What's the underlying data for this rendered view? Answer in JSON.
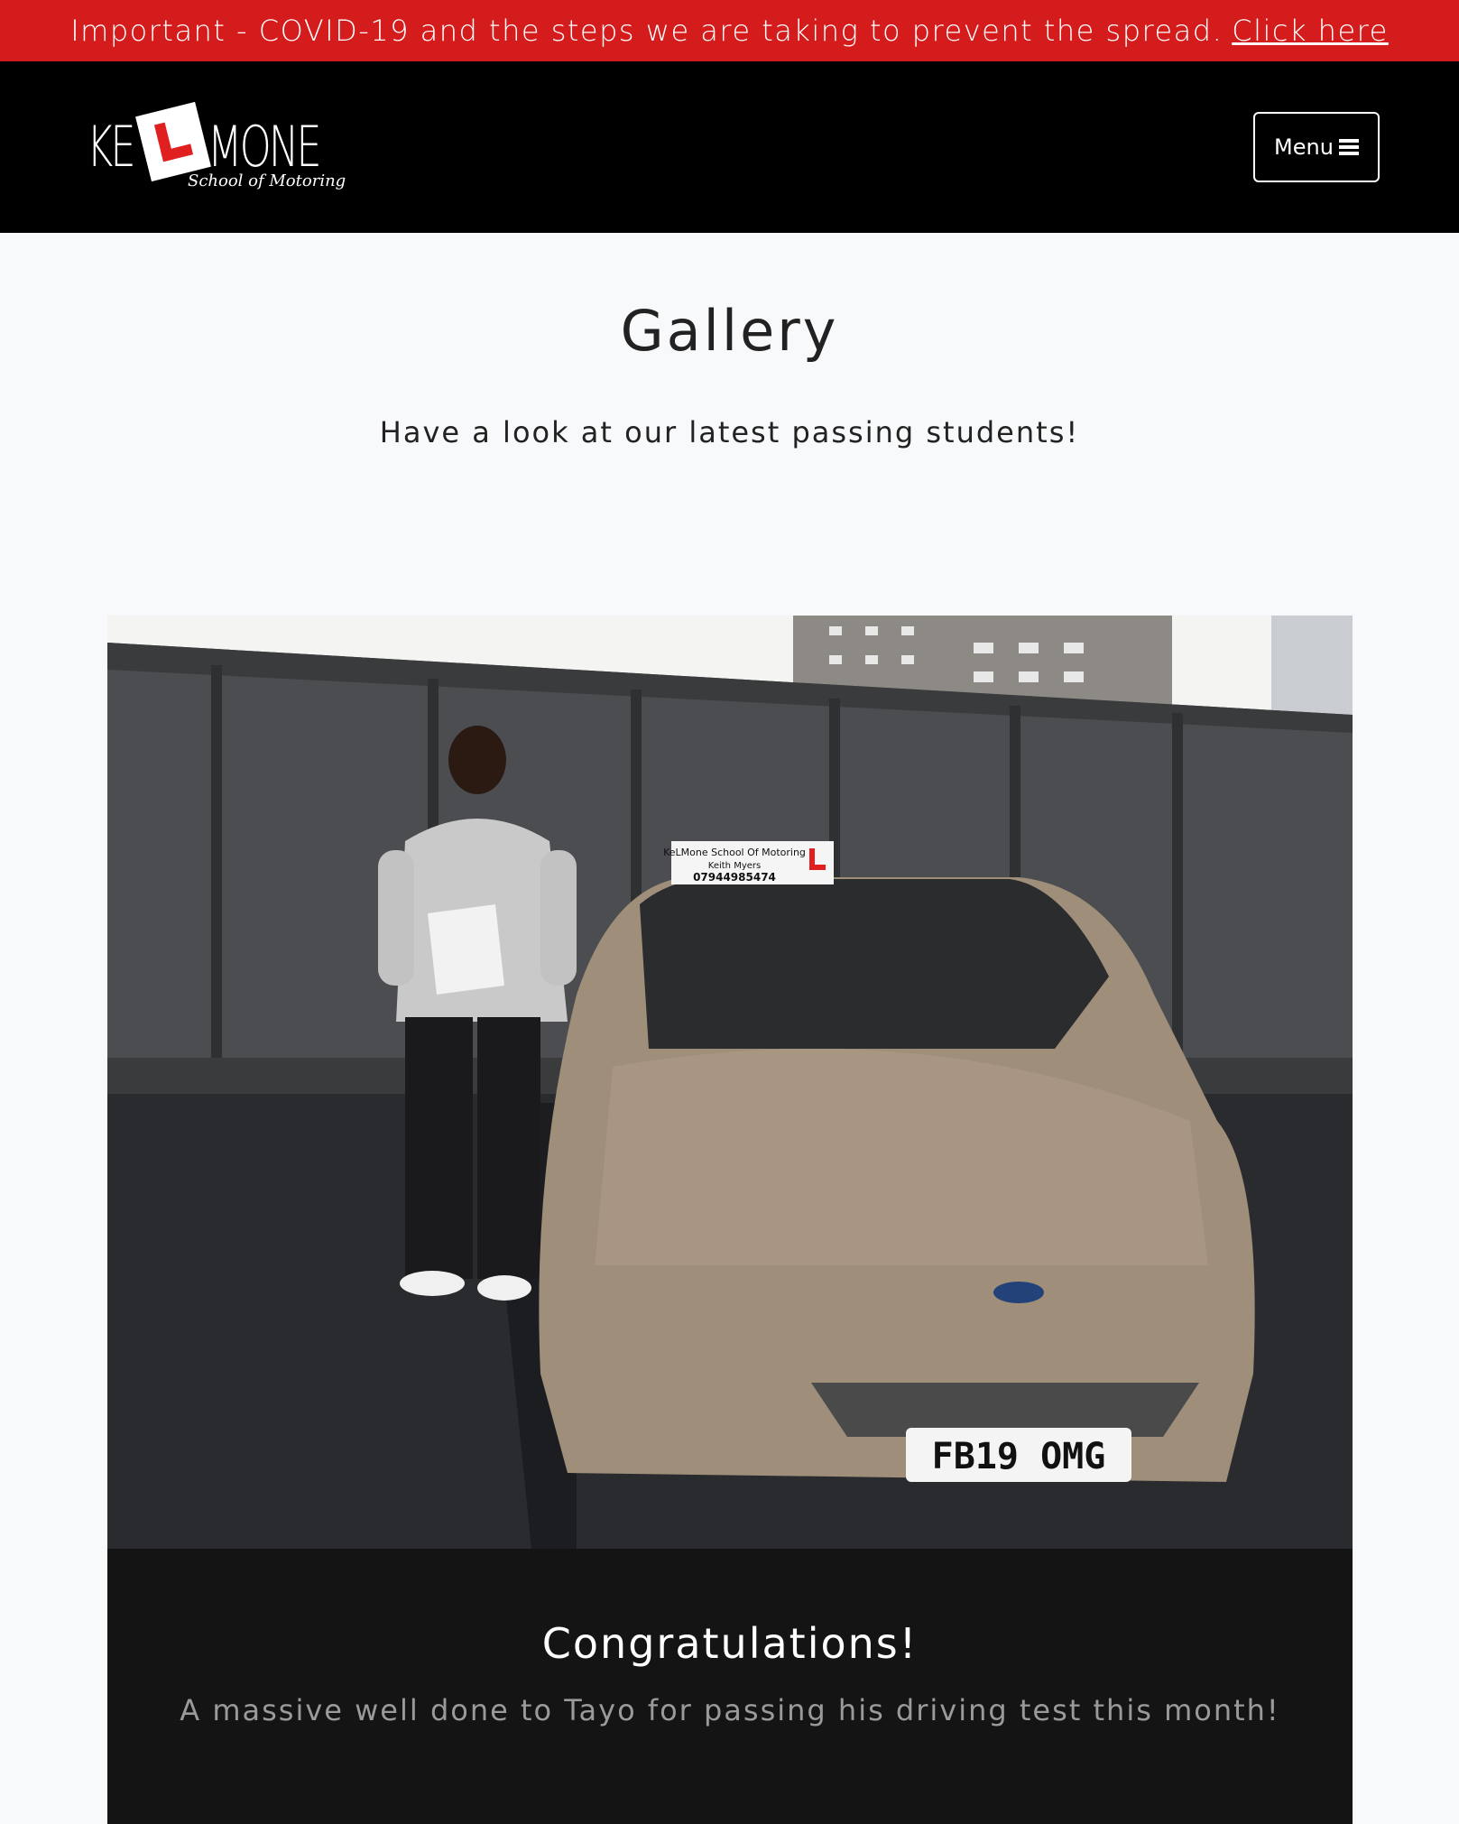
{
  "alert": {
    "message": "Important - COVID-19 and the steps we are taking to prevent the spread.",
    "link_label": "Click here"
  },
  "header": {
    "logo": {
      "left_text": "KE",
      "right_text": "MONE",
      "tagline": "School of Motoring"
    },
    "menu_label": "Menu"
  },
  "page": {
    "title": "Gallery",
    "intro": "Have a look at our latest passing students!"
  },
  "gallery": {
    "items": [
      {
        "photo_plate": "FB19 OMG",
        "roof_sign_line1": "KeLMone School Of Motoring",
        "roof_sign_line2": "Keith Myers",
        "roof_sign_line3": "07944985474",
        "caption_title": "Congratulations!",
        "caption_text": "A massive well done to Tayo for passing his driving test this month!"
      }
    ]
  },
  "colors": {
    "alert_bg": "#d41c1c",
    "nav_bg": "#000000",
    "caption_bg": "#141414",
    "accent_red": "#e02020"
  }
}
